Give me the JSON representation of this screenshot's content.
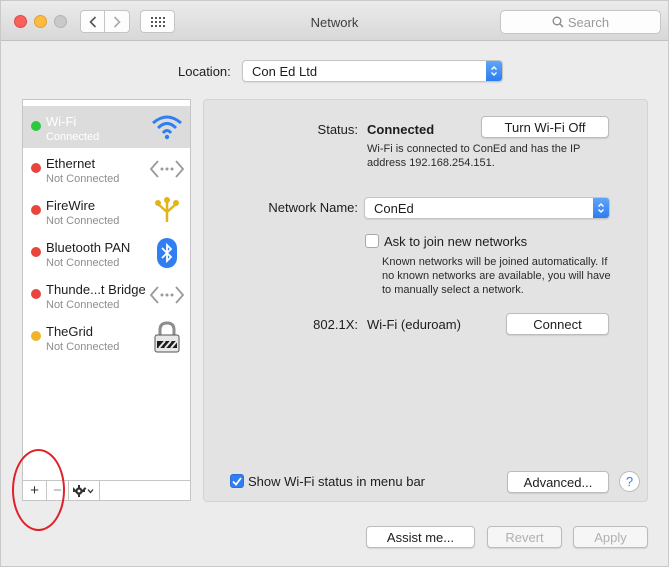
{
  "window": {
    "title": "Network"
  },
  "search": {
    "placeholder": "Search"
  },
  "location": {
    "label": "Location:",
    "value": "Con Ed Ltd"
  },
  "services": [
    {
      "name": "Wi-Fi",
      "status": "Connected",
      "dot_color": "#2bc840",
      "icon": "wifi-icon",
      "selected": true
    },
    {
      "name": "Ethernet",
      "status": "Not Connected",
      "dot_color": "#e8453c",
      "icon": "ethernet-icon"
    },
    {
      "name": "FireWire",
      "status": "Not Connected",
      "dot_color": "#e8453c",
      "icon": "firewire-icon"
    },
    {
      "name": "Bluetooth PAN",
      "status": "Not Connected",
      "dot_color": "#e8453c",
      "icon": "bluetooth-icon"
    },
    {
      "name": "Thunde...t Bridge",
      "status": "Not Connected",
      "dot_color": "#e8453c",
      "icon": "thunderbolt-bridge-icon"
    },
    {
      "name": "TheGrid",
      "status": "Not Connected",
      "dot_color": "#f0b429",
      "icon": "lock-icon"
    }
  ],
  "sidebar_controls": {
    "add": "+",
    "remove": "−"
  },
  "detail": {
    "status_label": "Status:",
    "status_value": "Connected",
    "turn_off_button": "Turn Wi-Fi Off",
    "status_desc_1": "Wi-Fi is connected to ConEd and has the IP",
    "status_desc_2": "address 192.168.254.151.",
    "network_name_label": "Network Name:",
    "network_name_value": "ConEd",
    "ask_join_label": "Ask to join new networks",
    "ask_join_checked": false,
    "ask_desc_1": "Known networks will be joined automatically. If",
    "ask_desc_2": "no known networks are available, you will have",
    "ask_desc_3": "to manually select a network.",
    "dot1x_label": "802.1X:",
    "dot1x_value": "Wi-Fi (eduroam)",
    "connect_button": "Connect",
    "show_status_label": "Show Wi-Fi status in menu bar",
    "show_status_checked": true,
    "advanced_button": "Advanced...",
    "help_button": "?"
  },
  "footer": {
    "assist_button": "Assist me...",
    "revert_button": "Revert",
    "apply_button": "Apply"
  }
}
